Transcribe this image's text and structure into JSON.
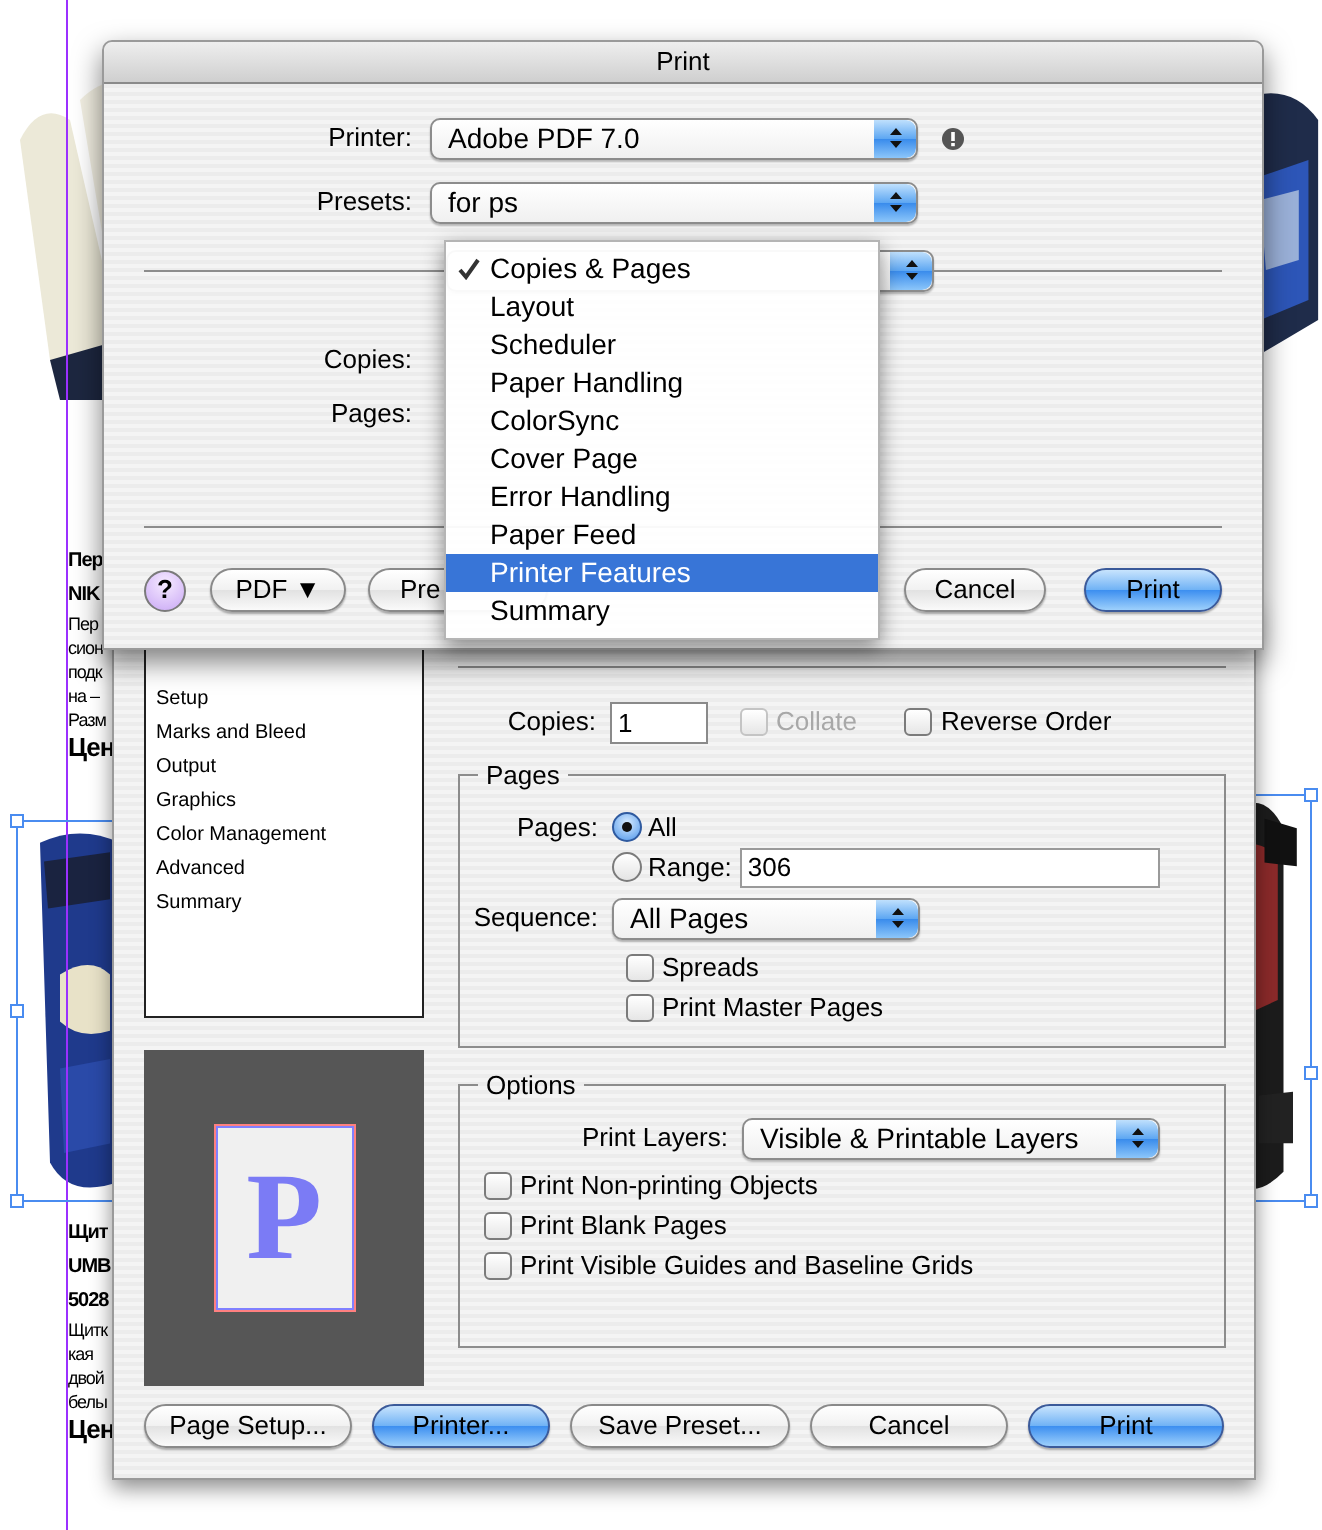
{
  "document": {
    "text_blocks": [
      {
        "lines": [
          {
            "text": "Пер",
            "kind": "heading"
          },
          {
            "text": "NIK",
            "kind": "heading"
          },
          {
            "text": "Пер",
            "kind": "body"
          },
          {
            "text": "сион",
            "kind": "body"
          },
          {
            "text": "подк",
            "kind": "body"
          },
          {
            "text": "на –",
            "kind": "body"
          },
          {
            "text": "Разм",
            "kind": "body"
          },
          {
            "text": "Цен",
            "kind": "price"
          }
        ]
      },
      {
        "lines": [
          {
            "text": "Щит",
            "kind": "heading"
          },
          {
            "text": "UMB",
            "kind": "heading"
          },
          {
            "text": "5028",
            "kind": "heading"
          },
          {
            "text": "Щитк",
            "kind": "body"
          },
          {
            "text": "кая",
            "kind": "body"
          },
          {
            "text": "двой",
            "kind": "body"
          },
          {
            "text": "белы",
            "kind": "body"
          },
          {
            "text": "Цен",
            "kind": "price"
          }
        ]
      }
    ]
  },
  "print_dialog": {
    "sidebar": {
      "items": [
        {
          "label": "Setup",
          "selected": false
        },
        {
          "label": "Marks and Bleed",
          "selected": false
        },
        {
          "label": "Output",
          "selected": false
        },
        {
          "label": "Graphics",
          "selected": false
        },
        {
          "label": "Color Management",
          "selected": false
        },
        {
          "label": "Advanced",
          "selected": false
        },
        {
          "label": "Summary",
          "selected": false
        }
      ]
    },
    "preview_letter": "P",
    "copies": {
      "label": "Copies:",
      "value": "1"
    },
    "collate": {
      "label": "Collate",
      "checked": false,
      "disabled": true
    },
    "reverse_order": {
      "label": "Reverse Order",
      "checked": false,
      "disabled": false
    },
    "pages_group": {
      "title": "Pages",
      "label": "Pages:",
      "options": [
        {
          "label": "All",
          "selected": true
        },
        {
          "label": "Range:",
          "selected": false
        }
      ],
      "range_value": "306",
      "sequence": {
        "label": "Sequence:",
        "value": "All Pages"
      },
      "checkboxes": [
        {
          "label": "Spreads",
          "checked": false
        },
        {
          "label": "Print Master Pages",
          "checked": false
        }
      ]
    },
    "options_group": {
      "title": "Options",
      "print_layers": {
        "label": "Print Layers:",
        "value": "Visible & Printable Layers"
      },
      "checkboxes": [
        {
          "label": "Print Non-printing Objects",
          "checked": false
        },
        {
          "label": "Print Blank Pages",
          "checked": false
        },
        {
          "label": "Print Visible Guides and Baseline Grids",
          "checked": false
        }
      ]
    },
    "buttons": [
      {
        "label": "Page Setup...",
        "default": false
      },
      {
        "label": "Printer...",
        "default": true
      },
      {
        "label": "Save Preset...",
        "default": false
      },
      {
        "label": "Cancel",
        "default": false
      },
      {
        "label": "Print",
        "default": true
      }
    ]
  },
  "print_sheet": {
    "title": "Print",
    "printer": {
      "label": "Printer:",
      "value": "Adobe PDF 7.0"
    },
    "presets": {
      "label": "Presets:",
      "value": "for ps"
    },
    "copies_label": "Copies:",
    "pages_label": "Pages:",
    "help": "?",
    "buttons": [
      {
        "label": "PDF ▼",
        "default": false
      },
      {
        "label": "Pre",
        "default": false
      },
      {
        "label": "Cancel",
        "default": false
      },
      {
        "label": "Print",
        "default": true
      }
    ]
  },
  "popup_menu": {
    "items": [
      {
        "label": "Copies & Pages",
        "checked": true,
        "selected": false
      },
      {
        "label": "Layout",
        "checked": false,
        "selected": false
      },
      {
        "label": "Scheduler",
        "checked": false,
        "selected": false
      },
      {
        "label": "Paper Handling",
        "checked": false,
        "selected": false
      },
      {
        "label": "ColorSync",
        "checked": false,
        "selected": false
      },
      {
        "label": "Cover Page",
        "checked": false,
        "selected": false
      },
      {
        "label": "Error Handling",
        "checked": false,
        "selected": false
      },
      {
        "label": "Paper Feed",
        "checked": false,
        "selected": false
      },
      {
        "label": "Printer Features",
        "checked": false,
        "selected": true
      },
      {
        "label": "Summary",
        "checked": false,
        "selected": false
      }
    ]
  }
}
